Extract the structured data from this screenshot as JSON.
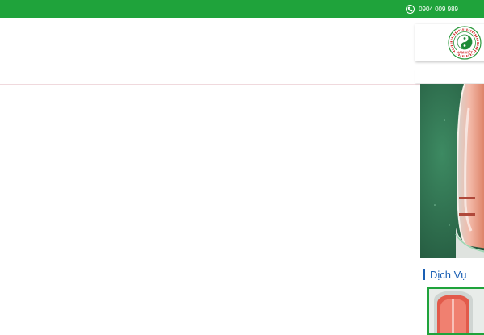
{
  "topbar": {
    "phone": "0904 009 989",
    "icon": "phone-icon",
    "color": "#1fa33b"
  },
  "header": {
    "logo": {
      "icon": "yin-yang-logo",
      "arc_text": "TRUNG TÂM VẬT LÝ TRỊ LIỆU",
      "brand": "NAM VIỆT"
    }
  },
  "sidebar": {
    "section_title": "Dịch Vụ",
    "accent": "#1a5fb4",
    "thumb_border": "#1fa33b"
  }
}
